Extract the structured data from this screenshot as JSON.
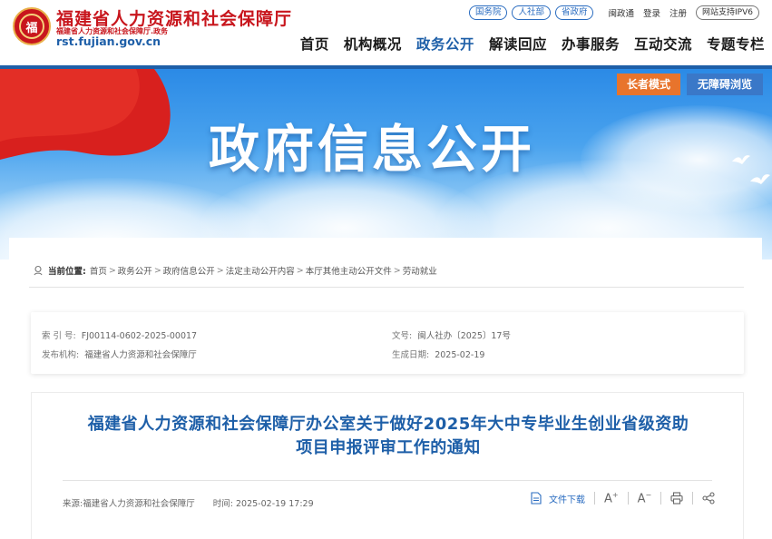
{
  "header": {
    "site_title": "福建省人力资源和社会保障厅",
    "site_subtitle": "福建省人力资源和社会保障厅.政务",
    "domain": "rst.fujian.gov.cn",
    "emblem_text": "福",
    "top_links": {
      "pill_gwy": "国务院",
      "pill_rsb": "人社部",
      "pill_szf": "省政府",
      "mzt": "闽政通",
      "login": "登录",
      "register": "注册",
      "ipv6": "网站支持IPV6"
    },
    "nav": [
      "首页",
      "机构概况",
      "政务公开",
      "解读回应",
      "办事服务",
      "互动交流",
      "专题专栏"
    ],
    "active_nav_index": 2
  },
  "banner": {
    "title": "政府信息公开",
    "elder_mode": "长者模式",
    "accessible": "无障碍浏览"
  },
  "breadcrumb": {
    "label": "当前位置:",
    "items": [
      "首页",
      "政务公开",
      "政府信息公开",
      "法定主动公开内容",
      "本厅其他主动公开文件",
      "劳动就业"
    ],
    "separator": ">"
  },
  "meta": {
    "index_label": "索 引 号:",
    "index_value": "FJ00114-0602-2025-00017",
    "doc_label": "文号:",
    "doc_value": "闽人社办〔2025〕17号",
    "org_label": "发布机构:",
    "org_value": "福建省人力资源和社会保障厅",
    "date_label": "生成日期:",
    "date_value": "2025-02-19"
  },
  "article": {
    "title_line1": "福建省人力资源和社会保障厅办公室关于做好2025年大中专毕业生创业省级资助",
    "title_line2": "项目申报评审工作的通知",
    "source": "来源:福建省人力资源和社会保障厅",
    "time_label": "时间:",
    "time_value": "2025-02-19 17:29",
    "download": "文件下载",
    "font_up": "A",
    "font_up_sup": "+",
    "font_down": "A",
    "font_down_sup": "−"
  },
  "colors": {
    "brand_red": "#c8161d",
    "brand_blue": "#1e5fa8",
    "elder_orange": "#e8742c",
    "access_blue": "#3a78c8"
  }
}
